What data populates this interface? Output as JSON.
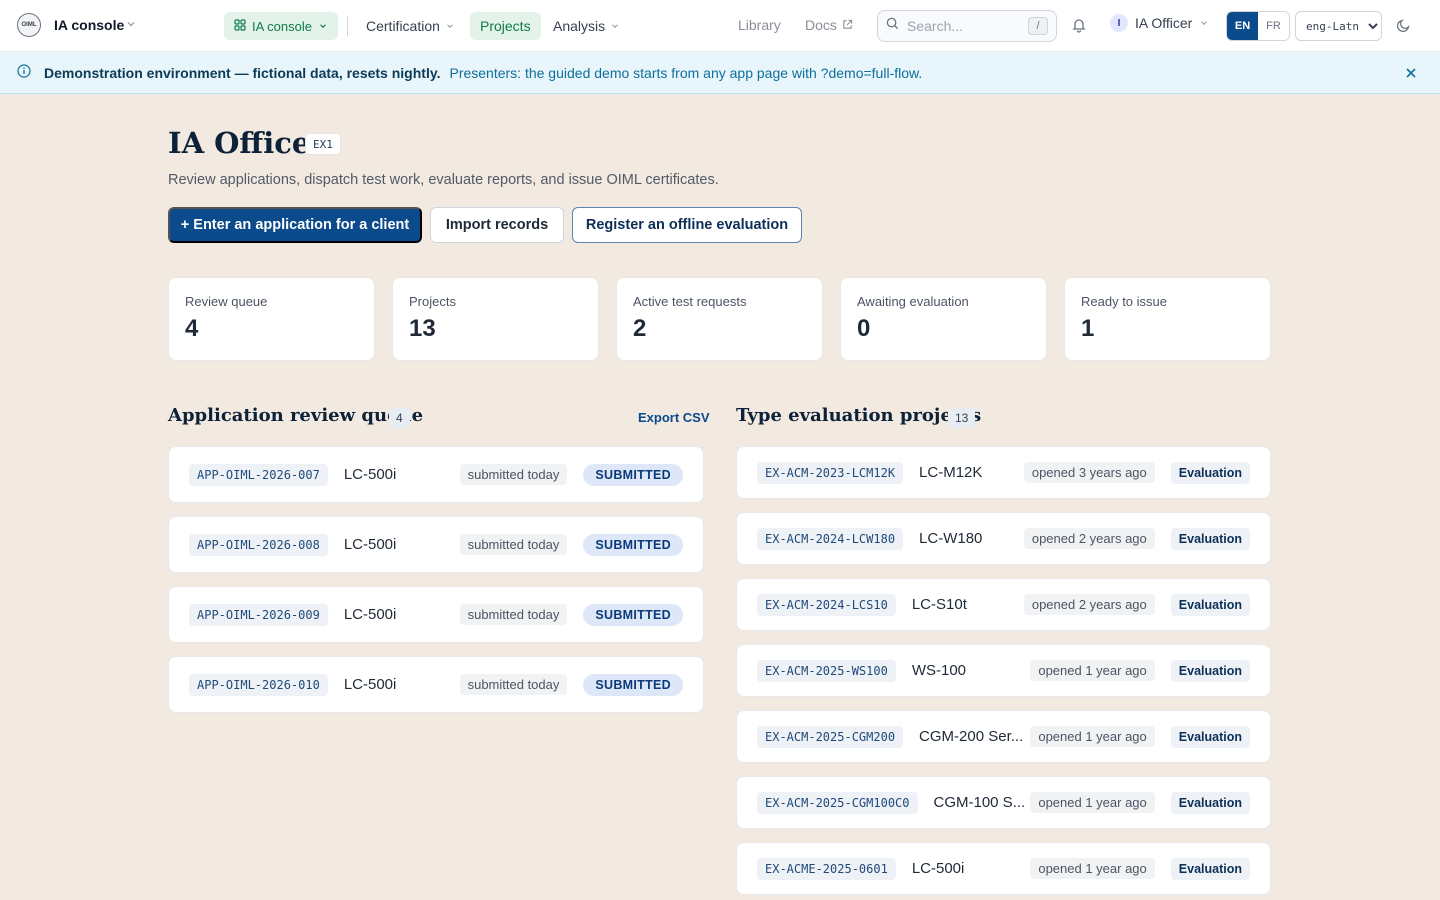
{
  "topbar": {
    "logo_text": "OIML",
    "app_name": "IA console",
    "context_label": "IA console",
    "nav": [
      {
        "label": "Certification",
        "has_menu": true,
        "active": false
      },
      {
        "label": "Projects",
        "has_menu": false,
        "active": true
      },
      {
        "label": "Analysis",
        "has_menu": true,
        "active": false
      }
    ],
    "links": [
      {
        "label": "Library",
        "external": false
      },
      {
        "label": "Docs",
        "external": true
      }
    ],
    "search": {
      "placeholder": "Search...",
      "shortcut": "/"
    },
    "user": {
      "initial": "I",
      "name": "IA Officer"
    },
    "languages": [
      {
        "code": "EN",
        "active": true
      },
      {
        "code": "FR",
        "active": false
      }
    ],
    "script": "eng-Latn",
    "icons": [
      "logo-icon",
      "chevron-down-icon",
      "grid-icon",
      "external-link-icon",
      "search-icon",
      "bell-icon",
      "moon-icon"
    ]
  },
  "banner": {
    "strong": "Demonstration environment — fictional data, resets nightly.",
    "message": "Presenters: the guided demo starts from any app page with ?demo=full-flow.",
    "icons": [
      "info-icon",
      "close-icon"
    ]
  },
  "header": {
    "title": "IA Officer",
    "badge": "EX1",
    "subtitle": "Review applications, dispatch test work, evaluate reports, and issue OIML certificates.",
    "buttons": {
      "primary": "+ Enter an application for a client",
      "secondary": "Import records",
      "outline": "Register an offline evaluation"
    }
  },
  "stats": [
    {
      "label": "Review queue",
      "value": "4"
    },
    {
      "label": "Projects",
      "value": "13"
    },
    {
      "label": "Active test requests",
      "value": "2"
    },
    {
      "label": "Awaiting evaluation",
      "value": "0"
    },
    {
      "label": "Ready to issue",
      "value": "1"
    }
  ],
  "review_queue": {
    "title": "Application review queue",
    "count": "4",
    "export_label": "Export CSV",
    "rows": [
      {
        "code": "APP-OIML-2026-007",
        "model": "LC-500i",
        "when": "submitted today",
        "status": "SUBMITTED"
      },
      {
        "code": "APP-OIML-2026-008",
        "model": "LC-500i",
        "when": "submitted today",
        "status": "SUBMITTED"
      },
      {
        "code": "APP-OIML-2026-009",
        "model": "LC-500i",
        "when": "submitted today",
        "status": "SUBMITTED"
      },
      {
        "code": "APP-OIML-2026-010",
        "model": "LC-500i",
        "when": "submitted today",
        "status": "SUBMITTED"
      }
    ]
  },
  "projects": {
    "title": "Type evaluation projects",
    "count": "13",
    "rows": [
      {
        "code": "EX-ACM-2023-LCM12K",
        "model": "LC-M12K",
        "when": "opened 3 years ago",
        "phase": "Evaluation"
      },
      {
        "code": "EX-ACM-2024-LCW180",
        "model": "LC-W180",
        "when": "opened 2 years ago",
        "phase": "Evaluation"
      },
      {
        "code": "EX-ACM-2024-LCS10",
        "model": "LC-S10t",
        "when": "opened 2 years ago",
        "phase": "Evaluation"
      },
      {
        "code": "EX-ACM-2025-WS100",
        "model": "WS-100",
        "when": "opened 1 year ago",
        "phase": "Evaluation"
      },
      {
        "code": "EX-ACM-2025-CGM200",
        "model": "CGM-200 Ser...",
        "when": "opened 1 year ago",
        "phase": "Evaluation"
      },
      {
        "code": "EX-ACM-2025-CGM100C0",
        "model": "CGM-100 S...",
        "when": "opened 1 year ago",
        "phase": "Evaluation"
      },
      {
        "code": "EX-ACME-2025-0601",
        "model": "LC-500i",
        "when": "opened 1 year ago",
        "phase": "Evaluation"
      }
    ]
  },
  "colors": {
    "background": "#f2e9e1",
    "primary": "#0b4a8b",
    "active_nav": "#0f7a4a",
    "banner": "#e8f5fb"
  }
}
